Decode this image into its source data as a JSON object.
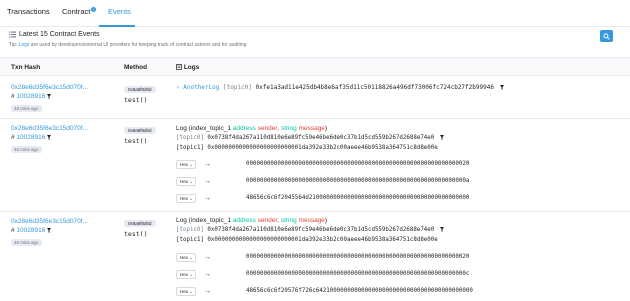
{
  "tabs": [
    {
      "label": "Transactions"
    },
    {
      "label": "Contract",
      "badge": "i"
    },
    {
      "label": "Events"
    }
  ],
  "header": {
    "title": "Latest 15 Contract Events",
    "tip_prefix": "Tip: ",
    "tip_link": "Logs",
    "tip_rest": " are used by developers/external UI providers for keeping track of contract actions and for auditing"
  },
  "table": {
    "columns": [
      "Txn Hash",
      "Method",
      "Logs"
    ]
  },
  "rows": [
    {
      "tx": "0x28e6d35f6e3c15d070f...",
      "block_prefix": "# ",
      "block": "10028916",
      "age": "48 mins ago",
      "method_id": "0x8a8f8d0d",
      "method_name": "test()",
      "log_event": "AnotherLog",
      "log_topic_label": "[topic0]",
      "log_topic_value": "0xfe1a3ad11e425db4b8e6af35d11c50118826a496df73006fc724cb27f2b99946"
    },
    {
      "tx": "0x28e6d35f6e3c15d070f...",
      "block_prefix": "# ",
      "block": "10028916",
      "age": "48 mins ago",
      "method_id": "0x8a8f8d0d",
      "method_name": "test()",
      "log_title": "Log (index_topic_1",
      "log_addr": "address",
      "log_sender": "sender,",
      "log_string": "string",
      "log_message": "message",
      "log_close": ")",
      "topic0_label": "[topic0]",
      "topic0_value": "0x0738f4da267a110d810e6e89fc59e46be6de0c37b1d5cd559b267d2688e74e0",
      "topic1_label": "[topic1]",
      "topic1_value": "0x0000000000000000000000001da392e33b2c00aeee46b9538a364751c8d8e00e",
      "data": [
        {
          "fmt": "Hex",
          "value": "0000000000000000000000000000000000000000000000000000000000000020"
        },
        {
          "fmt": "Hex",
          "value": "000000000000000000000000000000000000000000000000000000000000000a"
        },
        {
          "fmt": "Hex",
          "value": "48656c6c6f2045564d2100000000000000000000000000000000000000000000"
        }
      ]
    },
    {
      "tx": "0x28e6d35f6e3c15d070f...",
      "block_prefix": "# ",
      "block": "10028916",
      "age": "48 mins ago",
      "method_id": "0x8a8f8d0d",
      "method_name": "test()",
      "log_title": "Log (index_topic_1",
      "log_addr": "address",
      "log_sender": "sender,",
      "log_string": "string",
      "log_message": "message",
      "log_close": ")",
      "topic0_label": "[topic0]",
      "topic0_value": "0x0738f4da267a110d810e6e89fc59e46be6de0c37b1d5cd559b267d2688e74e0",
      "topic1_label": "[topic1]",
      "topic1_value": "0x0000000000000000000000001da392e33b2c00aeee46b9538a364751c8d8e00e",
      "data": [
        {
          "fmt": "Hex",
          "value": "0000000000000000000000000000000000000000000000000000000000000020"
        },
        {
          "fmt": "Hex",
          "value": "000000000000000000000000000000000000000000000000000000000000000c"
        },
        {
          "fmt": "Hex",
          "value": "48656c6c6f20576f726c642100000000000000000000000000000000000000000"
        }
      ]
    }
  ],
  "colors": {
    "accent": "#3498db",
    "green": "#00c9a7",
    "red": "#de4437",
    "muted": "#77838f"
  },
  "icons": [
    "info-icon",
    "list-icon",
    "search-icon",
    "filter-icon",
    "chevron-right-icon",
    "arrow-right-icon",
    "chevron-down-icon"
  ]
}
